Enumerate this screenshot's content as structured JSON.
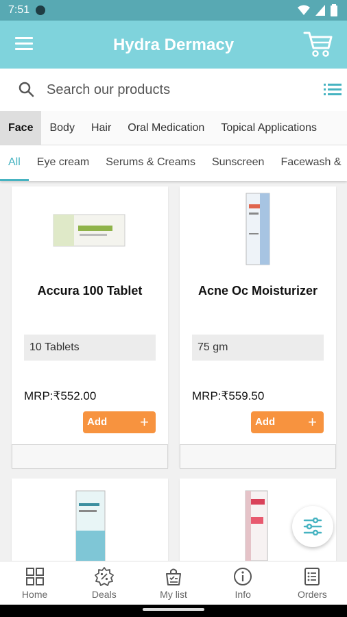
{
  "status_bar": {
    "time": "7:51"
  },
  "app_bar": {
    "title": "Hydra Dermacy"
  },
  "search": {
    "placeholder": "Search our products"
  },
  "category_tabs": [
    "Face",
    "Body",
    "Hair",
    "Oral Medication",
    "Topical Applications"
  ],
  "sub_tabs": [
    "All",
    "Eye cream",
    "Serums & Creams",
    "Sunscreen",
    "Facewash &"
  ],
  "products": [
    {
      "name": "Accura 100 Tablet",
      "quantity": "10 Tablets",
      "price": "MRP:₹552.00",
      "add_label": "Add"
    },
    {
      "name": "Acne Oc Moisturizer",
      "quantity": "75 gm",
      "price": "MRP:₹559.50",
      "add_label": "Add"
    }
  ],
  "bottom_nav": [
    {
      "label": "Home",
      "icon": "home-grid-icon"
    },
    {
      "label": "Deals",
      "icon": "deals-badge-icon"
    },
    {
      "label": "My list",
      "icon": "my-list-icon"
    },
    {
      "label": "Info",
      "icon": "info-icon"
    },
    {
      "label": "Orders",
      "icon": "orders-icon"
    }
  ],
  "colors": {
    "app_bar": "#7fd3dc",
    "status_bar": "#58a9b3",
    "accent": "#46b3c1",
    "add_button": "#f7933f"
  }
}
